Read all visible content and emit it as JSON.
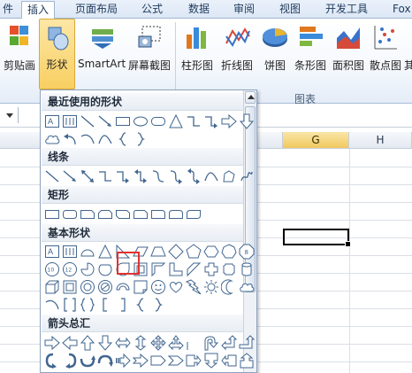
{
  "tabs": [
    {
      "label": "件",
      "active": false
    },
    {
      "label": "插入",
      "active": true
    },
    {
      "label": "页面布局",
      "active": false
    },
    {
      "label": "公式",
      "active": false
    },
    {
      "label": "数据",
      "active": false
    },
    {
      "label": "审阅",
      "active": false
    },
    {
      "label": "视图",
      "active": false
    },
    {
      "label": "开发工具",
      "active": false
    },
    {
      "label": "Fox",
      "active": false
    }
  ],
  "ribbon": {
    "buttons": [
      {
        "label": "剪贴画",
        "icon": "clipart-icon"
      },
      {
        "label": "形状",
        "icon": "shapes-icon",
        "selected": true
      },
      {
        "label": "SmartArt",
        "icon": "smartart-icon"
      },
      {
        "label": "屏幕截图",
        "icon": "screenshot-icon"
      },
      {
        "label": "柱形图",
        "icon": "column-chart-icon"
      },
      {
        "label": "折线图",
        "icon": "line-chart-icon"
      },
      {
        "label": "饼图",
        "icon": "pie-chart-icon"
      },
      {
        "label": "条形图",
        "icon": "bar-chart-icon"
      },
      {
        "label": "面积图",
        "icon": "area-chart-icon"
      },
      {
        "label": "散点图",
        "icon": "scatter-chart-icon"
      },
      {
        "label": "其",
        "icon": "other-chart-icon"
      }
    ],
    "group_label": "图表"
  },
  "sheet": {
    "columns": [
      {
        "label": "G",
        "active": true
      },
      {
        "label": "H",
        "active": false
      }
    ]
  },
  "shapes_menu": {
    "sections": [
      {
        "title": "最近使用的形状"
      },
      {
        "title": "线条"
      },
      {
        "title": "矩形"
      },
      {
        "title": "基本形状"
      },
      {
        "title": "箭头总汇"
      }
    ],
    "basic_shapes_row2_labels": [
      "10",
      "12"
    ]
  },
  "colors": {
    "accent": "#f8cf61",
    "highlight": "#e0322d",
    "shape_outline": "#41668f"
  }
}
